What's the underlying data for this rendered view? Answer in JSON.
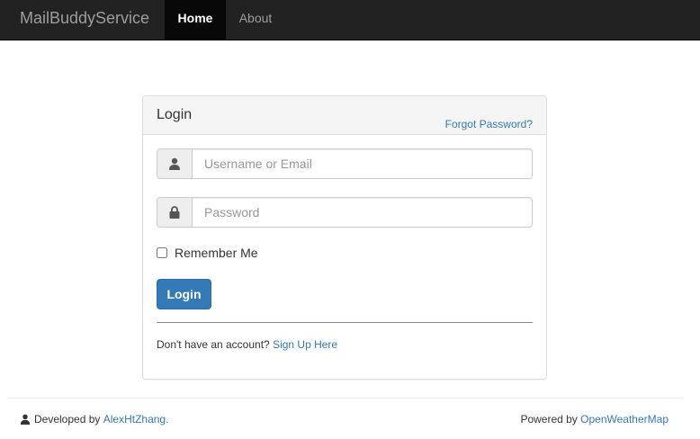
{
  "navbar": {
    "brand": "MailBuddyService",
    "items": [
      {
        "label": "Home",
        "active": true
      },
      {
        "label": "About",
        "active": false
      }
    ]
  },
  "login_panel": {
    "title": "Login",
    "forgot_link": "Forgot Password?",
    "username": {
      "placeholder": "Username or Email",
      "value": "",
      "icon": "user-icon"
    },
    "password": {
      "placeholder": "Password",
      "value": "",
      "icon": "lock-icon"
    },
    "remember_label": "Remember Me",
    "remember_checked": false,
    "submit_label": "Login",
    "signup_prompt": "Don't have an account?",
    "signup_link": "Sign Up Here"
  },
  "footer": {
    "developed_prefix": "Developed by",
    "developer_link": "AlexHtZhang.",
    "powered_prefix": "Powered by",
    "powered_link": "OpenWeatherMap",
    "developer_icon": "user-icon"
  },
  "colors": {
    "navbar_bg": "#222222",
    "link": "#337ab7",
    "primary_button": "#337ab7"
  }
}
